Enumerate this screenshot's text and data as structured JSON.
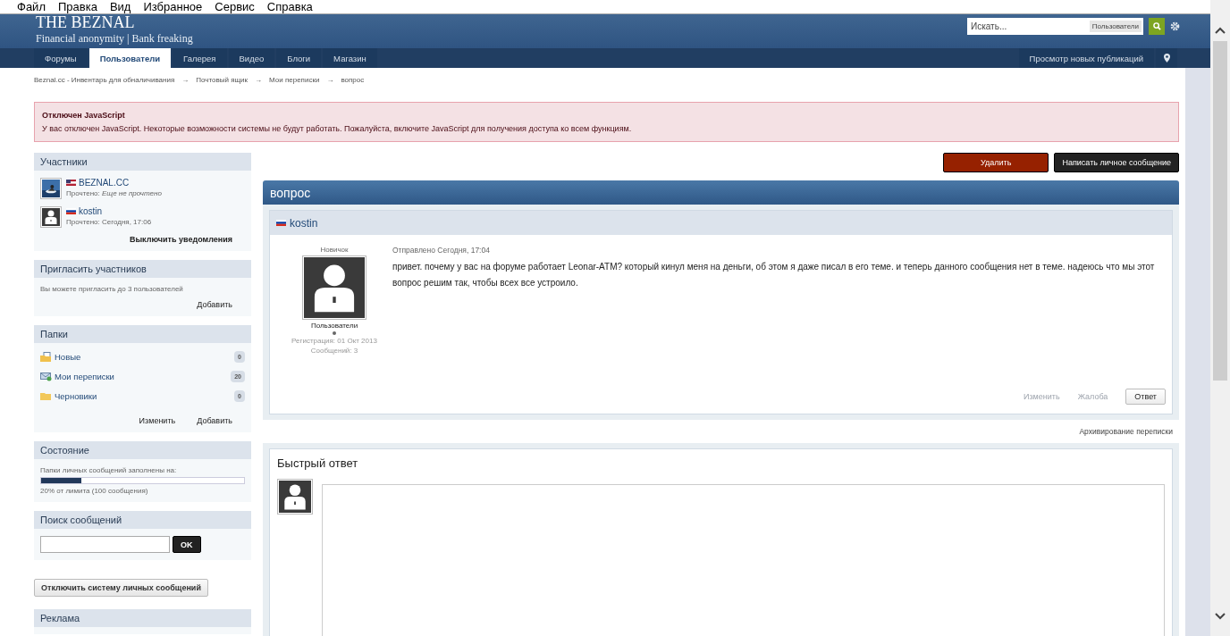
{
  "menu_bar": [
    "Файл",
    "Правка",
    "Вид",
    "Избранное",
    "Сервис",
    "Справка"
  ],
  "header": {
    "logo": "THE BEZNAL",
    "tagline": "Financial anonymity | Bank freaking",
    "search": {
      "placeholder": "Искать...",
      "scope": "Пользователи"
    }
  },
  "nav": {
    "tabs": [
      {
        "label": "Форумы",
        "selected": false
      },
      {
        "label": "Пользователи",
        "selected": true
      },
      {
        "label": "Галерея",
        "selected": false
      },
      {
        "label": "Видео",
        "selected": false
      },
      {
        "label": "Блоги",
        "selected": false
      },
      {
        "label": "Магазин",
        "selected": false
      }
    ],
    "new_posts": "Просмотр новых публикаций"
  },
  "breadcrumbs": [
    "Beznal.cc - Инвентарь для обналичивания",
    "Почтовый ящик",
    "Мои переписки",
    "вопрос"
  ],
  "breadcrumb_separator": "→",
  "notice": {
    "title": "Отключен JavaScript",
    "text": "У вас отключен JavaScript. Некоторые возможности системы не будут работать. Пожалуйста, включите JavaScript для получения доступа ко всем функциям."
  },
  "sidebar": {
    "participants": {
      "title": "Участники",
      "items": [
        {
          "name": "BEZNAL.CC",
          "flag": {
            "kind": "us"
          },
          "read": "Прочтено: *Еще не прочтено*"
        },
        {
          "name": "kostin",
          "flag": {
            "kind": "ru"
          },
          "avatar": {
            "kind": "default"
          },
          "read": "Прочтено: Сегодня, 17:06"
        }
      ],
      "action": "Выключить уведомления"
    },
    "invite": {
      "title": "Пригласить участников",
      "text": "Вы можете пригласить до 3 пользователей",
      "action": "Добавить"
    },
    "folders": {
      "title": "Папки",
      "items": [
        {
          "kind": "new",
          "label": "Новые",
          "count": "0"
        },
        {
          "kind": "mail",
          "label": "Мои переписки",
          "count": "20"
        },
        {
          "kind": "folder",
          "label": "Черновики",
          "count": "0"
        }
      ],
      "actions": [
        "Изменить",
        "Добавить"
      ]
    },
    "status": {
      "title": "Состояние",
      "label": "Папки личных сообщений заполнены на:",
      "level": 0.2,
      "text": "20% от лимита (100 сообщения)"
    },
    "search": {
      "title": "Поиск сообщений",
      "button": "OK"
    },
    "disable_button": "Отключить систему личных сообщений",
    "ads": {
      "title": "Реклама"
    }
  },
  "actions": [
    {
      "kind": "danger",
      "label": "Удалить"
    },
    {
      "kind": "dark",
      "label": "Написать личное сообщение"
    }
  ],
  "thread": {
    "title": "вопрос",
    "message": {
      "author": "kostin",
      "flag": {
        "kind": "ru"
      },
      "user_title": "Новичок",
      "group": "Пользователи",
      "registered": "Регистрация: 01 Окт 2013",
      "posts": "Сообщений: 3",
      "sent": "Отправлено Сегодня, 17:04",
      "text": "привет. почему у вас на форуме работает Leonar-ATM? который кинул меня на деньги, об этом я даже писал в его теме. и теперь данного сообщения нет в теме. надеюсь что мы этот вопрос решим так, чтобы всех все устроило.",
      "links": [
        {
          "label": "Изменить",
          "disabled": true
        },
        {
          "label": "Жалоба",
          "disabled": true
        }
      ],
      "reply": "Ответ"
    },
    "archive": "Архивирование переписки",
    "quick_reply": {
      "title": "Быстрый ответ"
    }
  }
}
